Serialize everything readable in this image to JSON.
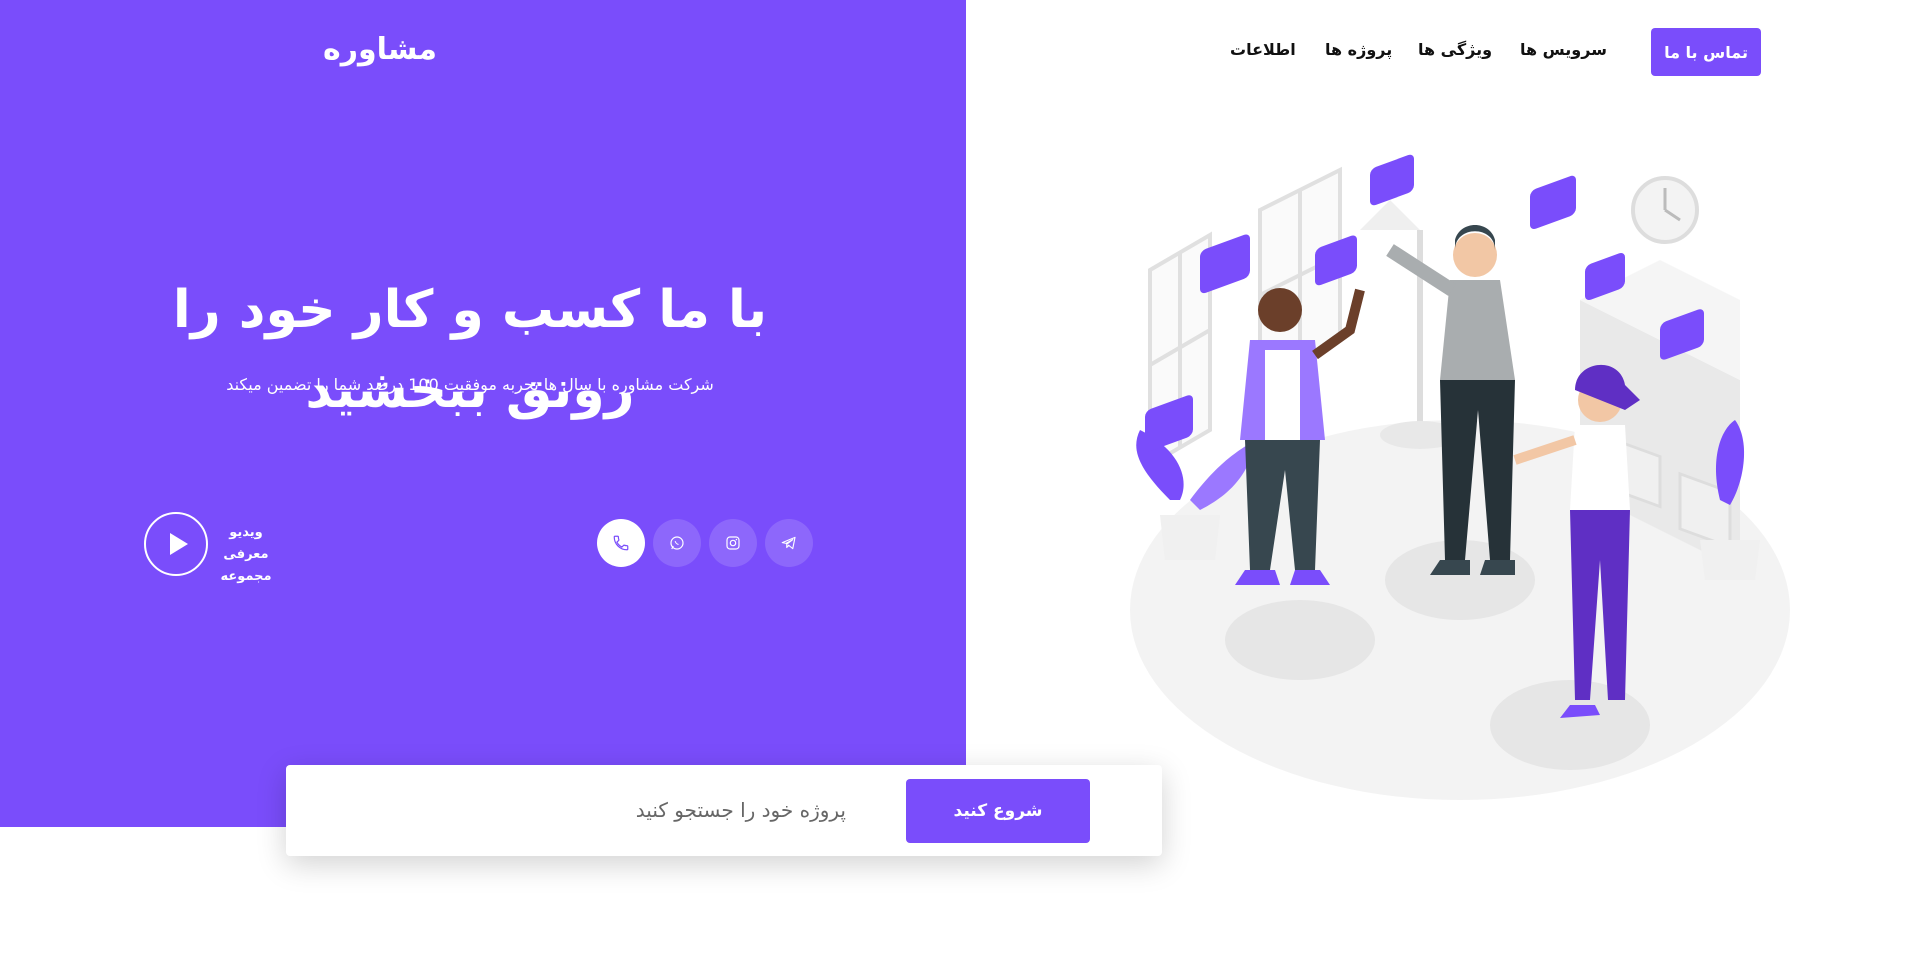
{
  "brand": {
    "logo_text": "مشاوره"
  },
  "nav": {
    "contact_label": "تماس با ما",
    "items": [
      {
        "label": "سرویس ها"
      },
      {
        "label": "ویژگی ها"
      },
      {
        "label": "پروژه ها"
      },
      {
        "label": "اطلاعات"
      }
    ]
  },
  "hero": {
    "title": "با ما کسب و کار خود را رونق ببخشید",
    "subtitle": "شرکت مشاوره با سال ها تجربه موفقیت 100 درصد شما را تضمین میکند",
    "video_label_line1": "ویدیو معرفی",
    "video_label_line2": "مجموعه"
  },
  "socials": [
    {
      "icon": "telegram-icon"
    },
    {
      "icon": "instagram-icon"
    },
    {
      "icon": "whatsapp-icon"
    },
    {
      "icon": "phone-icon"
    }
  ],
  "search": {
    "placeholder": "پروژه خود را جستجو کنید",
    "button_label": "شروع کنید"
  },
  "colors": {
    "accent": "#7a4dfb",
    "white": "#ffffff",
    "text": "#111111"
  }
}
